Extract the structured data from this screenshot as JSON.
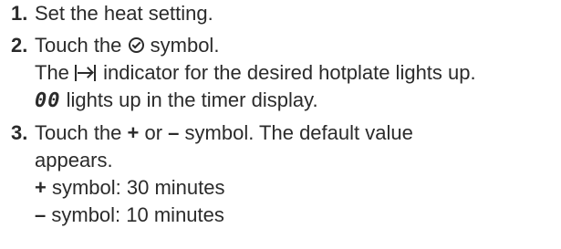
{
  "steps": [
    {
      "number": "1.",
      "lines": [
        {
          "text": "Set the heat setting."
        }
      ]
    },
    {
      "number": "2.",
      "line1_pre": "Touch the ",
      "line1_post": " symbol.",
      "timer_icon": "timer-icon",
      "line2_pre": "The ",
      "line2_post": " indicator for the desired hotplate lights up.",
      "hotplate_icon": "hotplate-indicator-icon",
      "line3_display": "00",
      "line3_post": " lights up in the timer display."
    },
    {
      "number": "3.",
      "line1_pre": "Touch the ",
      "plus": "+",
      "line1_mid": " or ",
      "minus": "–",
      "line1_post": " symbol. The default value",
      "line2": "appears.",
      "plus_item_symbol": "+",
      "plus_item_text": " symbol: 30 minutes",
      "minus_item_symbol": "–",
      "minus_item_text": " symbol: 10 minutes"
    }
  ]
}
